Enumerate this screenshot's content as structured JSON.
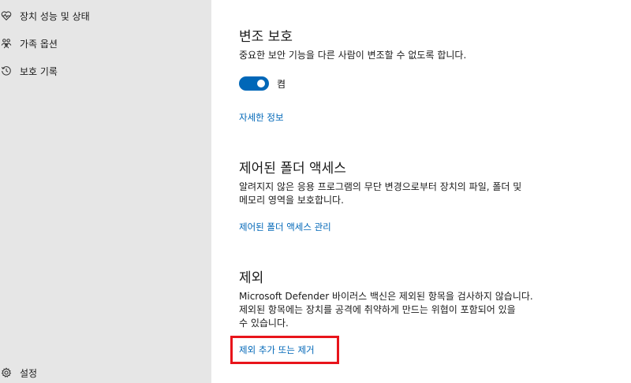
{
  "sidebar": {
    "items": [
      {
        "label": "장치 성능 및 상태",
        "icon": "heart-pulse-icon"
      },
      {
        "label": "가족 옵션",
        "icon": "family-icon"
      },
      {
        "label": "보호 기록",
        "icon": "history-icon"
      }
    ],
    "settings": {
      "label": "설정",
      "icon": "gear-icon"
    }
  },
  "tamper": {
    "title": "변조 보호",
    "description": "중요한 보안 기능을 다른 사람이 변조할 수 없도록 합니다.",
    "toggle_state": "켬",
    "toggle_on": true,
    "more_info_link": "자세한 정보"
  },
  "folder_access": {
    "title": "제어된 폴더 액세스",
    "description_line1": "알려지지 않은 응용 프로그램의 무단 변경으로부터 장치의 파일, 폴더 및",
    "description_line2": "메모리 영역을 보호합니다.",
    "manage_link": "제어된 폴더 액세스 관리"
  },
  "exclusions": {
    "title": "제외",
    "description_line1": "Microsoft Defender 바이러스 백신은 제외된 항목을 검사하지 않습니다.",
    "description_line2": "제외된 항목에는 장치를 공격에 취약하게 만드는 위협이 포함되어 있을",
    "description_line3": "수 있습니다.",
    "add_remove_link": "제외 추가 또는 제거"
  },
  "colors": {
    "accent": "#0067b8",
    "highlight": "#e8141b",
    "sidebar_bg": "#e6e6e6"
  }
}
